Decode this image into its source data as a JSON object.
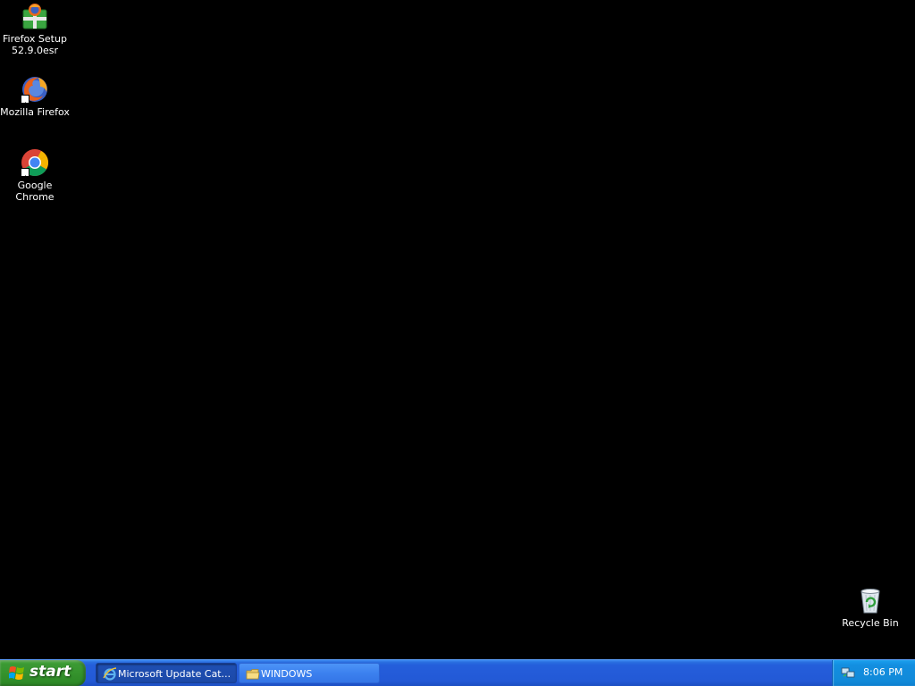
{
  "desktop": {
    "icons": [
      {
        "name": "Firefox Setup 52.9.0esr",
        "line1": "Firefox Setup",
        "line2": "52.9.0esr",
        "icon": "installer-package-icon"
      },
      {
        "name": "Mozilla Firefox",
        "line1": "Mozilla Firefox",
        "icon": "firefox-icon"
      },
      {
        "name": "Google Chrome",
        "line1": "Google Chrome",
        "icon": "chrome-icon"
      },
      {
        "name": "Recycle Bin",
        "line1": "Recycle Bin",
        "icon": "recycle-bin-icon"
      }
    ],
    "background_color": "#000000"
  },
  "taskbar": {
    "start_label": "start",
    "tasks": [
      {
        "label": "Microsoft Update Cat...",
        "icon": "internet-explorer-icon",
        "active": true
      },
      {
        "label": "WINDOWS",
        "icon": "folder-icon",
        "active": false
      }
    ],
    "tray": {
      "clock": "8:06 PM",
      "network_icon": "network-connection-icon"
    },
    "colors": {
      "taskbar": "#245edb",
      "start_button": "#3c9a34",
      "tray": "#118ad9"
    }
  }
}
